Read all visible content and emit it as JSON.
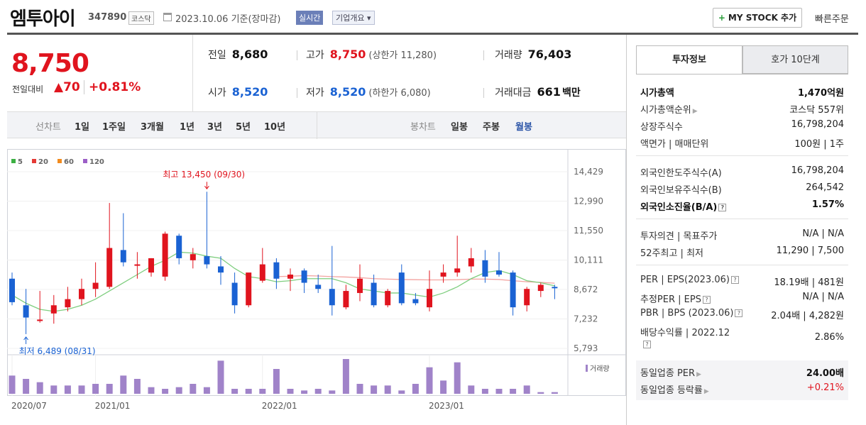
{
  "header": {
    "name": "엠투아이",
    "code": "347890",
    "market": "코스닥",
    "date": "2023.10.06 기준(장마감)",
    "realtime": "실시간",
    "company_info": "기업개요 ▾",
    "mystock": "MY STOCK 추가",
    "quick_order": "빠른주문"
  },
  "price": {
    "current": "8,750",
    "prev_label": "전일대비",
    "change": "▲70",
    "rate": "+0.81%"
  },
  "quote": {
    "prev_close_label": "전일",
    "prev_close": "8,680",
    "high_label": "고가",
    "high": "8,750",
    "upper_limit": "(상한가 11,280)",
    "volume_label": "거래량",
    "volume": "76,403",
    "open_label": "시가",
    "open": "8,520",
    "low_label": "저가",
    "low": "8,520",
    "lower_limit": "(하한가 6,080)",
    "amount_label": "거래대금",
    "amount": "661",
    "amount_unit": "백만"
  },
  "period": {
    "line_label": "선차트",
    "line_items": [
      "1일",
      "1주일",
      "3개월",
      "1년",
      "3년",
      "5년",
      "10년"
    ],
    "candle_label": "봉차트",
    "candle_items": [
      "일봉",
      "주봉",
      "월봉"
    ],
    "active": "월봉"
  },
  "chart_data": {
    "type": "candlestick",
    "legend": [
      "5",
      "20",
      "60",
      "120"
    ],
    "legend_colors": [
      "#3cb043",
      "#e53935",
      "#f28b1e",
      "#9c5fc7"
    ],
    "y_ticks": [
      "14,429",
      "12,990",
      "11,550",
      "10,111",
      "8,672",
      "7,232",
      "5,793"
    ],
    "ylim": [
      5793,
      14429
    ],
    "x_ticks": [
      "2020/07",
      "2021/01",
      "2022/01",
      "2023/01"
    ],
    "x_tick_index": [
      0,
      6,
      18,
      30
    ],
    "max_label": "최고 13,450 (09/30)",
    "min_label": "최저 6,489 (08/31)",
    "volume_label": "거래량",
    "up_color": "#e0141e",
    "down_color": "#1a62d3",
    "candles": [
      {
        "o": 9200,
        "h": 9500,
        "l": 7900,
        "c": 8050
      },
      {
        "o": 7900,
        "h": 8700,
        "l": 6489,
        "c": 7300
      },
      {
        "o": 7150,
        "h": 8600,
        "l": 7050,
        "c": 7200
      },
      {
        "o": 7500,
        "h": 8400,
        "l": 7000,
        "c": 7900
      },
      {
        "o": 7800,
        "h": 8800,
        "l": 7600,
        "c": 8200
      },
      {
        "o": 8200,
        "h": 9200,
        "l": 7900,
        "c": 8700
      },
      {
        "o": 8700,
        "h": 10000,
        "l": 8300,
        "c": 9000
      },
      {
        "o": 8800,
        "h": 12900,
        "l": 8700,
        "c": 10700
      },
      {
        "o": 10600,
        "h": 12400,
        "l": 9800,
        "c": 10000
      },
      {
        "o": 9900,
        "h": 10500,
        "l": 9200,
        "c": 9900
      },
      {
        "o": 9500,
        "h": 10200,
        "l": 9300,
        "c": 10200
      },
      {
        "o": 9300,
        "h": 11500,
        "l": 9100,
        "c": 11400
      },
      {
        "o": 11300,
        "h": 11400,
        "l": 9900,
        "c": 10200
      },
      {
        "o": 10100,
        "h": 10700,
        "l": 9700,
        "c": 10400
      },
      {
        "o": 10300,
        "h": 13450,
        "l": 9700,
        "c": 9900
      },
      {
        "o": 9800,
        "h": 10300,
        "l": 8900,
        "c": 9500
      },
      {
        "o": 9000,
        "h": 9500,
        "l": 7500,
        "c": 7900
      },
      {
        "o": 7900,
        "h": 9400,
        "l": 7800,
        "c": 9500
      },
      {
        "o": 9100,
        "h": 10700,
        "l": 9000,
        "c": 9900
      },
      {
        "o": 10000,
        "h": 10200,
        "l": 8700,
        "c": 9200
      },
      {
        "o": 9200,
        "h": 9700,
        "l": 8600,
        "c": 9400
      },
      {
        "o": 9600,
        "h": 9700,
        "l": 8500,
        "c": 9000
      },
      {
        "o": 8900,
        "h": 9400,
        "l": 8500,
        "c": 8700
      },
      {
        "o": 8700,
        "h": 10800,
        "l": 7400,
        "c": 7900
      },
      {
        "o": 7800,
        "h": 8900,
        "l": 7700,
        "c": 8600
      },
      {
        "o": 8500,
        "h": 9900,
        "l": 8100,
        "c": 9200
      },
      {
        "o": 9000,
        "h": 9400,
        "l": 7800,
        "c": 7900
      },
      {
        "o": 7900,
        "h": 8700,
        "l": 7800,
        "c": 8600
      },
      {
        "o": 9500,
        "h": 9900,
        "l": 7900,
        "c": 8000
      },
      {
        "o": 8200,
        "h": 8500,
        "l": 7900,
        "c": 8000
      },
      {
        "o": 7800,
        "h": 9600,
        "l": 7600,
        "c": 8700
      },
      {
        "o": 9300,
        "h": 9900,
        "l": 9000,
        "c": 9500
      },
      {
        "o": 9500,
        "h": 11300,
        "l": 9300,
        "c": 9700
      },
      {
        "o": 9800,
        "h": 10700,
        "l": 9500,
        "c": 10200
      },
      {
        "o": 10100,
        "h": 10600,
        "l": 9000,
        "c": 9300
      },
      {
        "o": 9600,
        "h": 10500,
        "l": 9300,
        "c": 9400
      },
      {
        "o": 9500,
        "h": 9600,
        "l": 7400,
        "c": 7800
      },
      {
        "o": 7900,
        "h": 8800,
        "l": 7600,
        "c": 8700
      },
      {
        "o": 8600,
        "h": 9000,
        "l": 8300,
        "c": 8900
      },
      {
        "o": 8800,
        "h": 8900,
        "l": 8200,
        "c": 8750
      }
    ],
    "ma5": [
      8400,
      8000,
      7700,
      7600,
      7700,
      7900,
      8200,
      8600,
      9000,
      9400,
      9800,
      10100,
      10500,
      10450,
      10300,
      10200,
      9700,
      9300,
      9200,
      9050,
      9100,
      9200,
      9200,
      9200,
      9000,
      8700,
      8600,
      8500,
      8500,
      8400,
      8300,
      8500,
      8800,
      9200,
      9500,
      9600,
      9400,
      9100,
      9000,
      8850
    ],
    "ma20": [
      null,
      null,
      null,
      null,
      null,
      null,
      null,
      null,
      null,
      null,
      null,
      null,
      null,
      null,
      null,
      null,
      null,
      null,
      null,
      9300,
      9320,
      9350,
      9330,
      9300,
      9280,
      9250,
      9200,
      9180,
      9160,
      9150,
      9140,
      9140,
      9150,
      9180,
      9180,
      9160,
      9100,
      9050,
      9020,
      8980
    ],
    "volumes": [
      11,
      9,
      7,
      5,
      5,
      5,
      6,
      6,
      11,
      9,
      4,
      3,
      4,
      6,
      4,
      20,
      3,
      3,
      3,
      15,
      3,
      2,
      3,
      2,
      21,
      6,
      5,
      5,
      2,
      6,
      16,
      8,
      19,
      5,
      3,
      3,
      3,
      5,
      1,
      1
    ]
  },
  "tabs": {
    "invest": "투자정보",
    "hoga": "호가 10단계"
  },
  "info": {
    "mcap_label": "시가총액",
    "mcap": "1,470억원",
    "mcap_rank_label": "시가총액순위",
    "mcap_rank": "코스닥 557위",
    "shares_label": "상장주식수",
    "shares": "16,798,204",
    "par_label": "액면가 | 매매단위",
    "par": "100원 | 1주",
    "foreign_limit_label": "외국인한도주식수(A)",
    "foreign_limit": "16,798,204",
    "foreign_hold_label": "외국인보유주식수(B)",
    "foreign_hold": "264,542",
    "foreign_rate_label": "외국인소진율(B/A)",
    "foreign_rate": "1.57%",
    "opinion_label": "투자의견 | 목표주가",
    "opinion": "N/A | N/A",
    "week52_label": "52주최고 | 최저",
    "week52": "11,290 | 7,500",
    "per_label": "PER | EPS(2023.06)",
    "per": "18.19배 | 481원",
    "est_per_label": "추정PER | EPS",
    "est_per": "N/A | N/A",
    "pbr_label": "PBR | BPS (2023.06)",
    "pbr": "2.04배 | 4,282원",
    "div_label": "배당수익률 | 2022.12",
    "div": "2.86%",
    "ind_per_label": "동일업종 PER",
    "ind_per": "24.00배",
    "ind_rate_label": "동일업종 등락률",
    "ind_rate": "+0.21%"
  }
}
